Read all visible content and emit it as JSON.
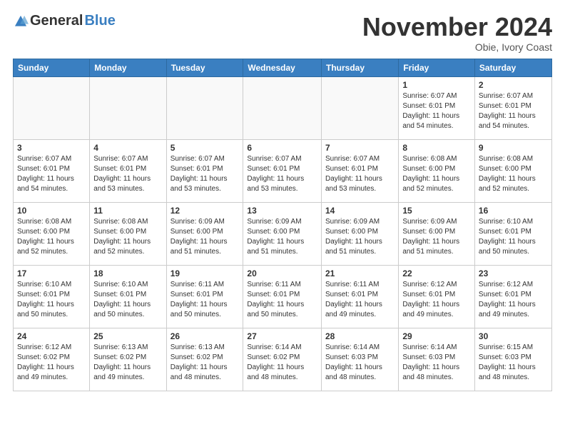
{
  "header": {
    "logo_general": "General",
    "logo_blue": "Blue",
    "month_title": "November 2024",
    "location": "Obie, Ivory Coast"
  },
  "days_of_week": [
    "Sunday",
    "Monday",
    "Tuesday",
    "Wednesday",
    "Thursday",
    "Friday",
    "Saturday"
  ],
  "weeks": [
    [
      {
        "day": "",
        "info": ""
      },
      {
        "day": "",
        "info": ""
      },
      {
        "day": "",
        "info": ""
      },
      {
        "day": "",
        "info": ""
      },
      {
        "day": "",
        "info": ""
      },
      {
        "day": "1",
        "info": "Sunrise: 6:07 AM\nSunset: 6:01 PM\nDaylight: 11 hours and 54 minutes."
      },
      {
        "day": "2",
        "info": "Sunrise: 6:07 AM\nSunset: 6:01 PM\nDaylight: 11 hours and 54 minutes."
      }
    ],
    [
      {
        "day": "3",
        "info": "Sunrise: 6:07 AM\nSunset: 6:01 PM\nDaylight: 11 hours and 54 minutes."
      },
      {
        "day": "4",
        "info": "Sunrise: 6:07 AM\nSunset: 6:01 PM\nDaylight: 11 hours and 53 minutes."
      },
      {
        "day": "5",
        "info": "Sunrise: 6:07 AM\nSunset: 6:01 PM\nDaylight: 11 hours and 53 minutes."
      },
      {
        "day": "6",
        "info": "Sunrise: 6:07 AM\nSunset: 6:01 PM\nDaylight: 11 hours and 53 minutes."
      },
      {
        "day": "7",
        "info": "Sunrise: 6:07 AM\nSunset: 6:01 PM\nDaylight: 11 hours and 53 minutes."
      },
      {
        "day": "8",
        "info": "Sunrise: 6:08 AM\nSunset: 6:00 PM\nDaylight: 11 hours and 52 minutes."
      },
      {
        "day": "9",
        "info": "Sunrise: 6:08 AM\nSunset: 6:00 PM\nDaylight: 11 hours and 52 minutes."
      }
    ],
    [
      {
        "day": "10",
        "info": "Sunrise: 6:08 AM\nSunset: 6:00 PM\nDaylight: 11 hours and 52 minutes."
      },
      {
        "day": "11",
        "info": "Sunrise: 6:08 AM\nSunset: 6:00 PM\nDaylight: 11 hours and 52 minutes."
      },
      {
        "day": "12",
        "info": "Sunrise: 6:09 AM\nSunset: 6:00 PM\nDaylight: 11 hours and 51 minutes."
      },
      {
        "day": "13",
        "info": "Sunrise: 6:09 AM\nSunset: 6:00 PM\nDaylight: 11 hours and 51 minutes."
      },
      {
        "day": "14",
        "info": "Sunrise: 6:09 AM\nSunset: 6:00 PM\nDaylight: 11 hours and 51 minutes."
      },
      {
        "day": "15",
        "info": "Sunrise: 6:09 AM\nSunset: 6:00 PM\nDaylight: 11 hours and 51 minutes."
      },
      {
        "day": "16",
        "info": "Sunrise: 6:10 AM\nSunset: 6:01 PM\nDaylight: 11 hours and 50 minutes."
      }
    ],
    [
      {
        "day": "17",
        "info": "Sunrise: 6:10 AM\nSunset: 6:01 PM\nDaylight: 11 hours and 50 minutes."
      },
      {
        "day": "18",
        "info": "Sunrise: 6:10 AM\nSunset: 6:01 PM\nDaylight: 11 hours and 50 minutes."
      },
      {
        "day": "19",
        "info": "Sunrise: 6:11 AM\nSunset: 6:01 PM\nDaylight: 11 hours and 50 minutes."
      },
      {
        "day": "20",
        "info": "Sunrise: 6:11 AM\nSunset: 6:01 PM\nDaylight: 11 hours and 50 minutes."
      },
      {
        "day": "21",
        "info": "Sunrise: 6:11 AM\nSunset: 6:01 PM\nDaylight: 11 hours and 49 minutes."
      },
      {
        "day": "22",
        "info": "Sunrise: 6:12 AM\nSunset: 6:01 PM\nDaylight: 11 hours and 49 minutes."
      },
      {
        "day": "23",
        "info": "Sunrise: 6:12 AM\nSunset: 6:01 PM\nDaylight: 11 hours and 49 minutes."
      }
    ],
    [
      {
        "day": "24",
        "info": "Sunrise: 6:12 AM\nSunset: 6:02 PM\nDaylight: 11 hours and 49 minutes."
      },
      {
        "day": "25",
        "info": "Sunrise: 6:13 AM\nSunset: 6:02 PM\nDaylight: 11 hours and 49 minutes."
      },
      {
        "day": "26",
        "info": "Sunrise: 6:13 AM\nSunset: 6:02 PM\nDaylight: 11 hours and 48 minutes."
      },
      {
        "day": "27",
        "info": "Sunrise: 6:14 AM\nSunset: 6:02 PM\nDaylight: 11 hours and 48 minutes."
      },
      {
        "day": "28",
        "info": "Sunrise: 6:14 AM\nSunset: 6:03 PM\nDaylight: 11 hours and 48 minutes."
      },
      {
        "day": "29",
        "info": "Sunrise: 6:14 AM\nSunset: 6:03 PM\nDaylight: 11 hours and 48 minutes."
      },
      {
        "day": "30",
        "info": "Sunrise: 6:15 AM\nSunset: 6:03 PM\nDaylight: 11 hours and 48 minutes."
      }
    ]
  ]
}
